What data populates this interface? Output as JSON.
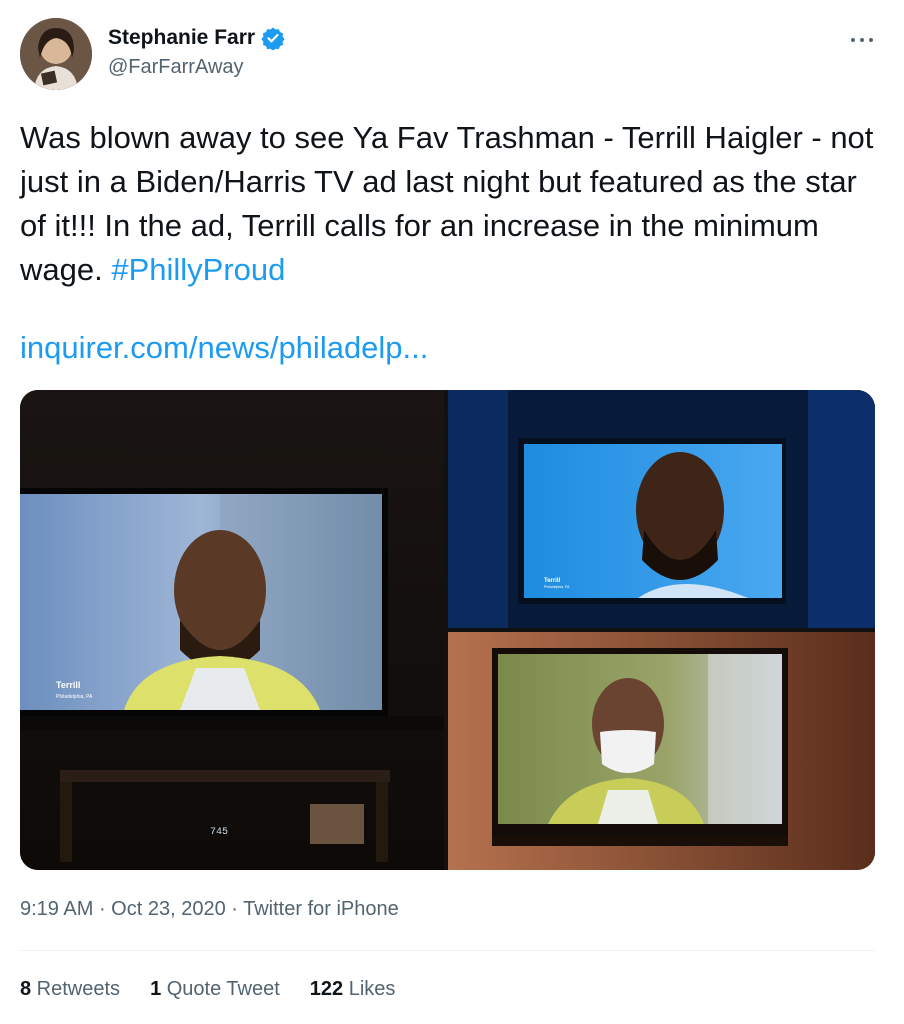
{
  "author": {
    "display_name": "Stephanie Farr",
    "handle": "@FarFarrAway",
    "verified": true,
    "avatar_icon": "profile-photo-avatar"
  },
  "menu_icon": "more-horizontal-icon",
  "text": {
    "body": "Was blown away to see Ya Fav Trashman - Terrill Haigler - not just in a Biden/Harris TV ad last night but featured as the star of it!!! In the ad, Terrill calls for an increase in the minimum wage. ",
    "hashtag": "#PhillyProud",
    "link": "inquirer.com/news/philadelp..."
  },
  "media": {
    "photo1": {
      "caption_name": "Terrill",
      "caption_place": "Philadelphia, PA",
      "clock": "745"
    },
    "photo2": {
      "caption_name": "Terrill",
      "caption_place": "Philadelphia, PA"
    },
    "photo3": {}
  },
  "meta": {
    "time": "9:19 AM",
    "sep1": " · ",
    "date": "Oct 23, 2020",
    "sep2": " · ",
    "source": "Twitter for iPhone"
  },
  "stats": {
    "retweets_count": "8",
    "retweets_label": " Retweets",
    "quotes_count": "1",
    "quotes_label": " Quote Tweet",
    "likes_count": "122",
    "likes_label": " Likes"
  },
  "colors": {
    "accent": "#1d9bf0",
    "secondary_text": "#536471",
    "primary_text": "#0f1419"
  }
}
